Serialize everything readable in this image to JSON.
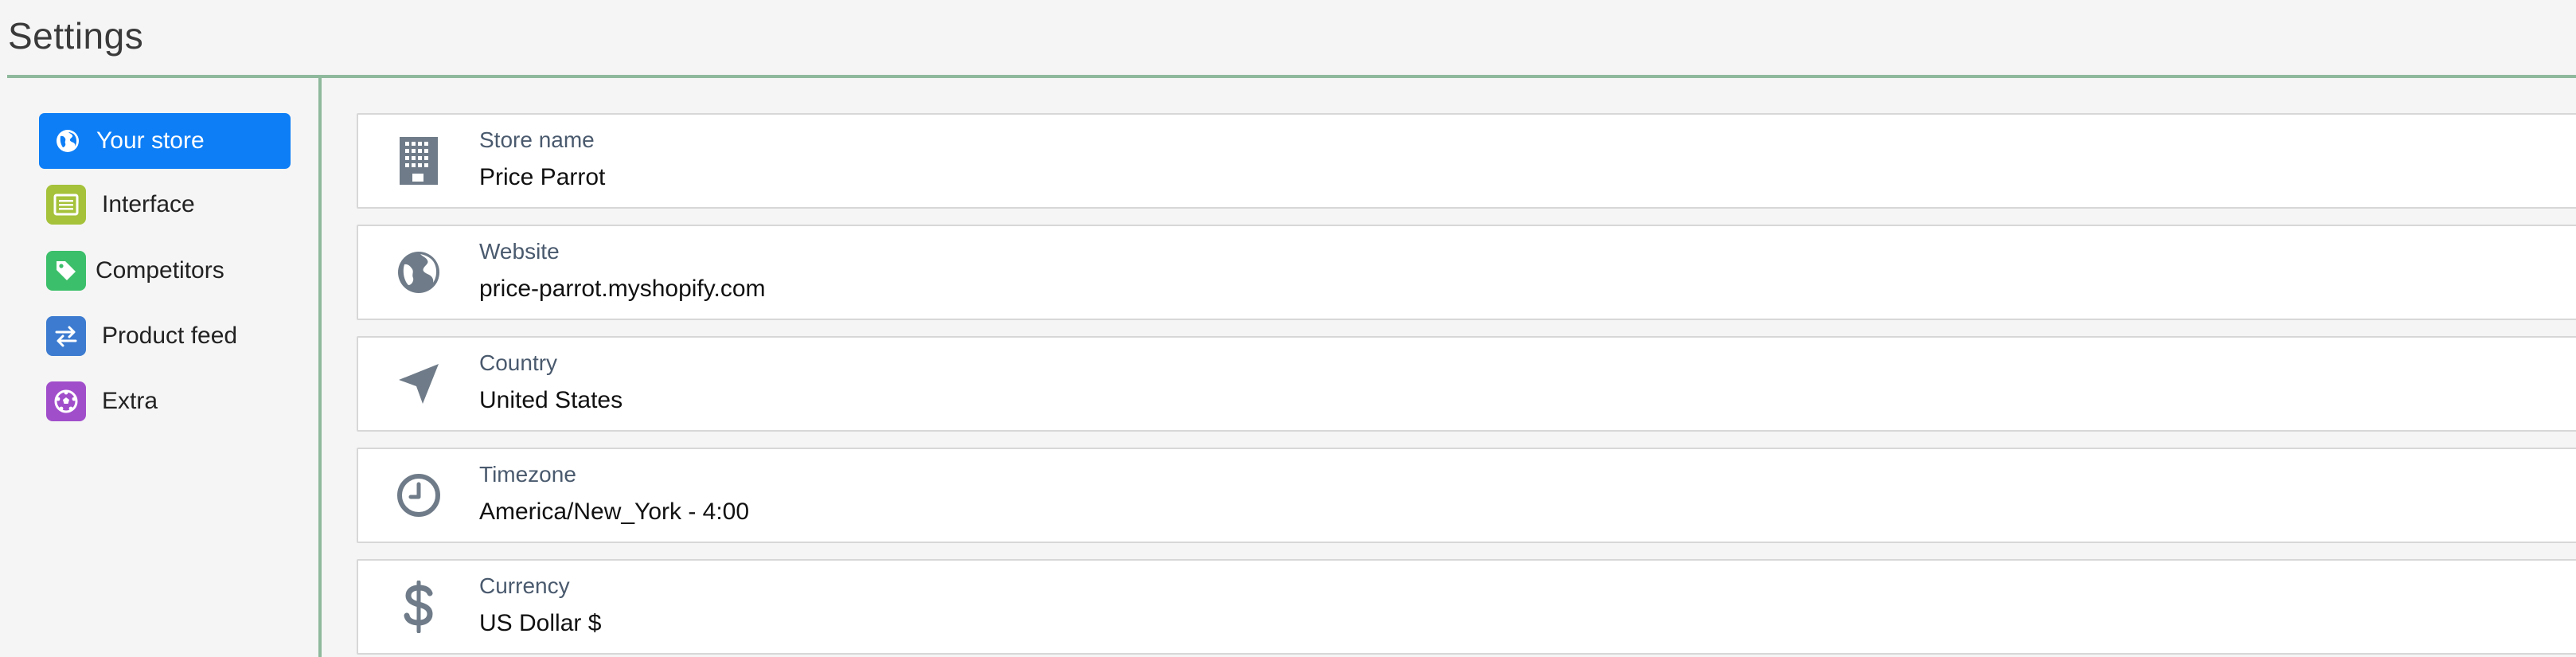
{
  "header": {
    "title": "Settings"
  },
  "sidebar": {
    "items": [
      {
        "id": "your-store",
        "label": "Your store",
        "icon": "globe-icon",
        "active": true,
        "color": "#0d7ef6"
      },
      {
        "id": "interface",
        "label": "Interface",
        "icon": "list-window-icon",
        "active": false,
        "color": "#a5c23a"
      },
      {
        "id": "competitors",
        "label": "Competitors",
        "icon": "tag-icon",
        "active": false,
        "color": "#3cbf6a"
      },
      {
        "id": "product-feed",
        "label": "Product feed",
        "icon": "swap-arrows-icon",
        "active": false,
        "color": "#3c7bd0"
      },
      {
        "id": "extra",
        "label": "Extra",
        "icon": "soccer-ball-icon",
        "active": false,
        "color": "#a14ecb"
      }
    ]
  },
  "settings": {
    "fields": [
      {
        "label": "Store name",
        "value": "Price Parrot",
        "icon": "building-icon"
      },
      {
        "label": "Website",
        "value": "price-parrot.myshopify.com",
        "icon": "globe-icon"
      },
      {
        "label": "Country",
        "value": "United States",
        "icon": "location-arrow-icon"
      },
      {
        "label": "Timezone",
        "value": "America/New_York - 4:00",
        "icon": "clock-icon"
      },
      {
        "label": "Currency",
        "value": "US Dollar $",
        "icon": "dollar-icon"
      }
    ]
  },
  "colors": {
    "accent": "#0d7ef6",
    "divider": "#8fb99c",
    "icon_gray": "#6f7b88"
  }
}
